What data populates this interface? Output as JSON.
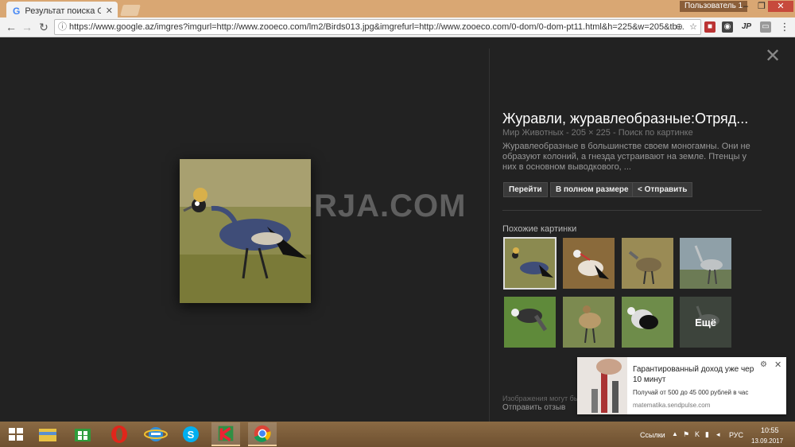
{
  "browser": {
    "tab_title": "Результат поиска Google",
    "tab_icon": "G",
    "user_label": "Пользователь 1",
    "url": "https://www.google.az/imgres?imgurl=http://www.zooeco.com/lm2/Birds013.jpg&imgrefurl=http://www.zooeco.com/0-dom/0-dom-pt11.html&h=225&w=205&tb...",
    "info_icon": "ⓘ",
    "window_min": "–",
    "window_max": "❐",
    "window_close": "✕"
  },
  "extensions": {
    "ext3_label": "JP"
  },
  "viewer": {
    "close_symbol": "✕",
    "watermark": "RJA.COM",
    "title": "Журавли, журавлеобразные:Отряд...",
    "meta": "Мир Животных  -  205 × 225  -  Поиск по картинке",
    "description": "Журавлеобразные в большинстве своем моногамны. Они не образуют колоний, а гнезда устраивают на земле. Птенцы у них в основном выводкового, ...",
    "buttons": {
      "go": "Перейти",
      "full_size": "В полном размере",
      "share": "Отправить"
    },
    "similar_title": "Похожие картинки",
    "more_label": "Ещё",
    "footer_note": "Изображения могут бы",
    "feedback": "Отправить отзыв"
  },
  "notification": {
    "title": "Гарантированный доход уже чер 10 минут",
    "body": "Получай от 500 до 45 000 рублей в час",
    "site": "matematika.sendpulse.com"
  },
  "taskbar": {
    "links_label": "Ссылки",
    "chevron": "▲",
    "lang": "РУС",
    "time": "10:55",
    "date": "13.09.2017"
  },
  "colors": {
    "title_bar": "#d9a773",
    "viewer_bg": "#222222",
    "taskbar": "#7a5c3a",
    "close_button": "#c74a3c"
  }
}
